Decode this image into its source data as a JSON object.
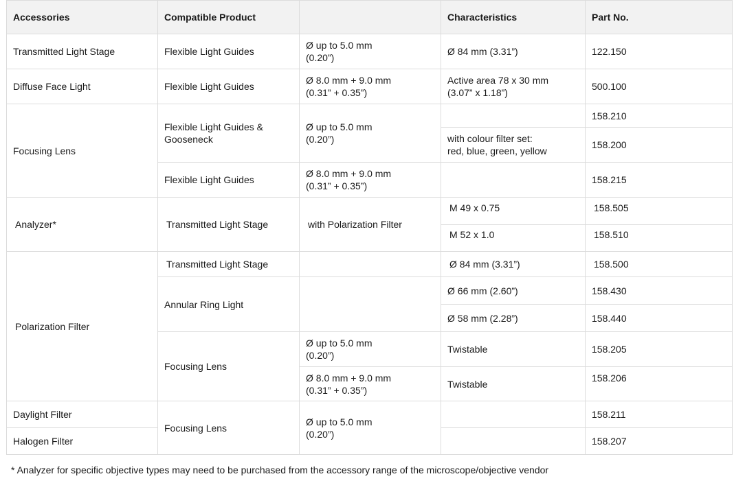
{
  "table": {
    "headers": {
      "accessories": "Accessories",
      "compatible_product": "Compatible Product",
      "spec": "",
      "characteristics": "Characteristics",
      "part_no": "Part No."
    },
    "rows": [
      {
        "accessory": "Transmitted Light Stage",
        "compatible": "Flexible Light Guides",
        "spec": [
          "Ø up to 5.0 mm",
          "(0.20”)"
        ],
        "characteristics": "Ø 84 mm (3.31”)",
        "part_no": "122.150"
      },
      {
        "accessory": "Diffuse Face Light",
        "compatible": "Flexible Light Guides",
        "spec": [
          "Ø 8.0 mm + 9.0 mm",
          "(0.31” + 0.35”)"
        ],
        "characteristics": [
          "Active area 78 x 30 mm",
          "(3.07” x 1.18”)"
        ],
        "part_no": "500.100"
      },
      {
        "accessory": "Focusing Lens",
        "sub": [
          {
            "compatible": [
              "Flexible Light Guides &",
              "Gooseneck"
            ],
            "spec": [
              "Ø up to 5.0 mm",
              "(0.20”)"
            ],
            "items": [
              {
                "characteristics": "",
                "part_no": "158.210"
              },
              {
                "characteristics": [
                  "with colour filter set:",
                  "red, blue, green, yellow"
                ],
                "part_no": "158.200"
              }
            ]
          },
          {
            "compatible": "Flexible Light Guides",
            "spec": [
              "Ø 8.0 mm + 9.0 mm",
              "(0.31” + 0.35”)"
            ],
            "items": [
              {
                "characteristics": "",
                "part_no": "158.215"
              }
            ]
          }
        ]
      },
      {
        "accessory": "Analyzer*",
        "compatible": "Transmitted Light Stage",
        "spec": "with Polarization Filter",
        "items": [
          {
            "characteristics": "M 49 x 0.75",
            "part_no": "158.505"
          },
          {
            "characteristics": "M 52 x 1.0",
            "part_no": "158.510"
          }
        ]
      },
      {
        "accessory": "Polarization Filter",
        "sub": [
          {
            "compatible": "Transmitted Light Stage",
            "spec": "",
            "items": [
              {
                "characteristics": "Ø 84 mm (3.31”)",
                "part_no": "158.500"
              }
            ]
          },
          {
            "compatible": "Annular Ring Light",
            "spec": "",
            "items": [
              {
                "characteristics": "Ø 66 mm (2.60”)",
                "part_no": "158.430"
              },
              {
                "characteristics": "Ø 58 mm (2.28”)",
                "part_no": "158.440"
              }
            ]
          },
          {
            "compatible": "Focusing Lens",
            "items": [
              {
                "spec": [
                  "Ø up to 5.0 mm",
                  "(0.20”)"
                ],
                "characteristics": "Twistable",
                "part_no": "158.205"
              },
              {
                "spec": [
                  "Ø 8.0 mm + 9.0 mm",
                  "(0.31” + 0.35”)"
                ],
                "characteristics": "Twistable",
                "part_no": "158.206"
              }
            ]
          }
        ]
      },
      {
        "accessories": [
          "Daylight Filter",
          "Halogen Filter"
        ],
        "compatible": "Focusing Lens",
        "spec": [
          "Ø up to 5.0 mm",
          "(0.20”)"
        ],
        "items": [
          {
            "characteristics": "",
            "part_no": "158.211"
          },
          {
            "characteristics": "",
            "part_no": "158.207"
          }
        ]
      }
    ]
  },
  "footnote": "* Analyzer for specific objective types may need to be purchased from the accessory range of the microscope/objective vendor"
}
